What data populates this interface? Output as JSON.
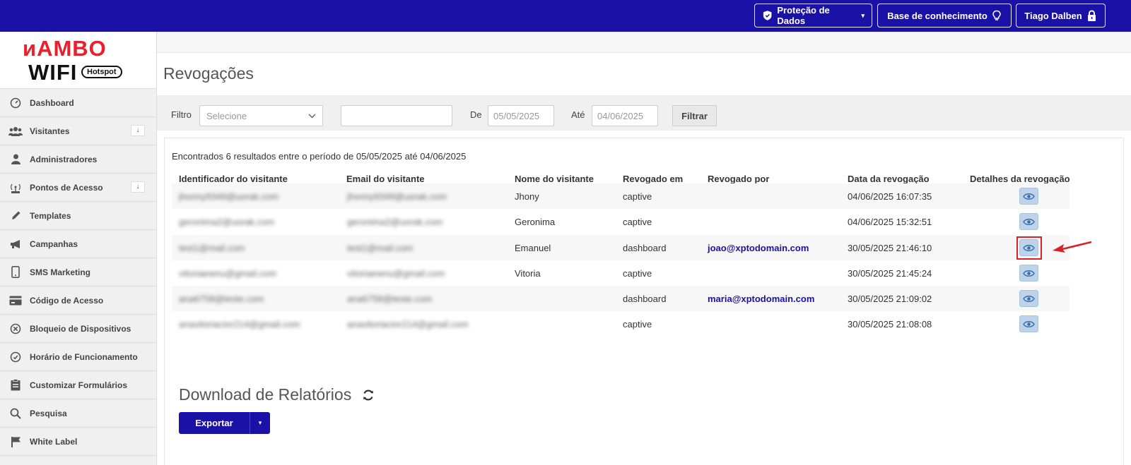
{
  "topbar": {
    "data_protection": "Proteção de Dados",
    "knowledge_base": "Base de conhecimento",
    "user": "Tiago Dalben"
  },
  "logo": {
    "line1": "AMBO",
    "line2": "WIFI",
    "badge": "Hotspot"
  },
  "sidebar": {
    "items": [
      {
        "label": "Dashboard",
        "icon": "gauge-icon"
      },
      {
        "label": "Visitantes",
        "icon": "users-icon",
        "badge": "↓"
      },
      {
        "label": "Administradores",
        "icon": "user-icon"
      },
      {
        "label": "Pontos de Acesso",
        "icon": "antenna-icon",
        "badge": "↓"
      },
      {
        "label": "Templates",
        "icon": "pencil-icon"
      },
      {
        "label": "Campanhas",
        "icon": "megaphone-icon"
      },
      {
        "label": "SMS Marketing",
        "icon": "phone-icon"
      },
      {
        "label": "Código de Acesso",
        "icon": "card-icon"
      },
      {
        "label": "Bloqueio de Dispositivos",
        "icon": "block-icon"
      },
      {
        "label": "Horário de Funcionamento",
        "icon": "clock-icon"
      },
      {
        "label": "Customizar Formulários",
        "icon": "clipboard-icon"
      },
      {
        "label": "Pesquisa",
        "icon": "search-icon"
      },
      {
        "label": "White Label",
        "icon": "flag-icon"
      }
    ]
  },
  "page": {
    "title": "Revogações"
  },
  "filter": {
    "label": "Filtro",
    "select_value": "Selecione",
    "text_value": "",
    "from_label": "De",
    "from_value": "05/05/2025",
    "to_label": "Até",
    "to_value": "04/06/2025",
    "button": "Filtrar"
  },
  "results_text": "Encontrados 6 resultados entre o período de 05/05/2025 até 04/06/2025",
  "table": {
    "headers": [
      "Identificador do visitante",
      "Email do visitante",
      "Nome do visitante",
      "Revogado em",
      "Revogado por",
      "Data da revogação",
      "Detalhes da revogação"
    ],
    "rows": [
      {
        "id": "jhonny9349@uorak.com",
        "email": "jhonny9349@uorak.com",
        "name": "Jhony",
        "revoked_in": "captive",
        "revoked_by": "",
        "date": "04/06/2025 16:07:35"
      },
      {
        "id": "geronima2@uorak.com",
        "email": "geronima2@uorak.com",
        "name": "Geronima",
        "revoked_in": "captive",
        "revoked_by": "",
        "date": "04/06/2025 15:32:51"
      },
      {
        "id": "test1@mail.com",
        "email": "test1@mail.com",
        "name": "Emanuel",
        "revoked_in": "dashboard",
        "revoked_by": "joao@xptodomain.com",
        "date": "30/05/2025 21:46:10"
      },
      {
        "id": "vitoriaewnu@gmail.com",
        "email": "vitoriaewnu@gmail.com",
        "name": "Vitoria",
        "revoked_in": "captive",
        "revoked_by": "",
        "date": "30/05/2025 21:45:24"
      },
      {
        "id": "ana6758@teste.com",
        "email": "ana6758@teste.com",
        "name": "",
        "revoked_in": "dashboard",
        "revoked_by": "maria@xptodomain.com",
        "date": "30/05/2025 21:09:02"
      },
      {
        "id": "anavitoriacior214@gmail.com",
        "email": "anavitoriacior214@gmail.com",
        "name": "",
        "revoked_in": "captive",
        "revoked_by": "",
        "date": "30/05/2025 21:08:08"
      }
    ]
  },
  "downloads": {
    "title": "Download de Relatórios",
    "export_button": "Exportar"
  },
  "colors": {
    "brand_blue": "#1a12a6",
    "brand_red": "#e8202d",
    "highlight_red": "#d6222a"
  }
}
